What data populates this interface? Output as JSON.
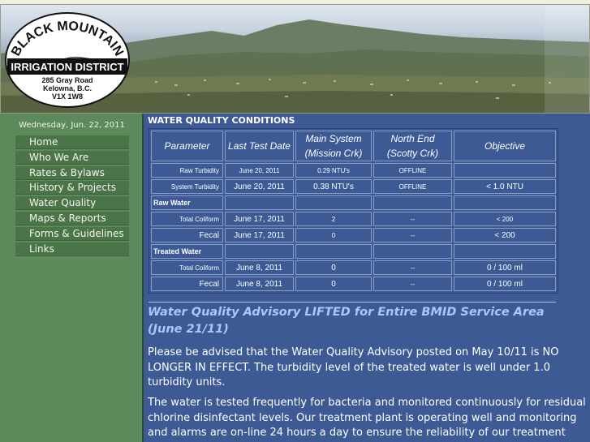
{
  "header": {
    "logo": {
      "name_top": "BLACK MOUNTAIN",
      "name_bottom": "IRRIGATION DISTRICT",
      "address_line1": "285 Gray Road",
      "address_line2": "Kelowna, B.C.",
      "address_line3": "V1X 1W8"
    }
  },
  "sidebar": {
    "date": "Wednesday, Jun. 22, 2011",
    "nav": [
      {
        "label": "Home"
      },
      {
        "label": "Who We Are"
      },
      {
        "label": "Rates & Bylaws"
      },
      {
        "label": "History & Projects"
      },
      {
        "label": "Water Quality"
      },
      {
        "label": "Maps & Reports"
      },
      {
        "label": "Forms & Guidelines"
      },
      {
        "label": "Links"
      }
    ]
  },
  "main": {
    "section_title": "WATER QUALITY CONDITIONS",
    "table": {
      "headers": {
        "parameter": "Parameter",
        "last_test_date": "Last Test Date",
        "main_line1": "Main System",
        "main_line2": "(Mission Crk)",
        "north_line1": "North End",
        "north_line2": "(Scotty Crk)",
        "objective": "Objective"
      },
      "rows": {
        "raw_turbidity": {
          "parameter": "Raw Turbidity",
          "date": "June 20, 2011",
          "main": "0.29 NTU's",
          "north": "OFFLINE",
          "objective": ""
        },
        "system_turbidity": {
          "parameter": "System Turbidity",
          "date": "June 20, 2011",
          "main": "0.38 NTU's",
          "north": "OFFLINE",
          "objective": "< 1.0 NTU"
        },
        "raw_water_section": "Raw Water",
        "raw_total_coliform": {
          "parameter": "Total Coliform",
          "date": "June 17, 2011",
          "main": "2",
          "north": "--",
          "objective": "< 200"
        },
        "raw_fecal": {
          "parameter": "Fecal",
          "date": "June 17, 2011",
          "main": "0",
          "north": "--",
          "objective": "< 200"
        },
        "treated_water_section": "Treated Water",
        "treated_total_coliform": {
          "parameter": "Total Coliform",
          "date": "June 8, 2011",
          "main": "0",
          "north": "--",
          "objective": "0 / 100 ml"
        },
        "treated_fecal": {
          "parameter": "Fecal",
          "date": "June 8, 2011",
          "main": "0",
          "north": "--",
          "objective": "0 / 100 ml"
        }
      }
    },
    "advisory": {
      "title": "Water Quality Advisory LIFTED for Entire BMID Service Area (June 21/11)",
      "paragraph1": "Please be advised that the Water Quality Advisory posted on May 10/11 is NO LONGER IN EFFECT.  The turbidity level of the treated water is well under 1.0 turbidity units.",
      "paragraph2": "The water is tested frequently for bacteria and monitored continuously for residual chlorine disinfectant levels.  Our treatment plant is operating well and monitoring and alarms are on-line 24 hours a day to ensure the reliability of our treatment process."
    }
  },
  "colors": {
    "sidebar_green": "#5d8a5b",
    "nav_item_green": "#4c7449",
    "main_blue": "#3d5a95",
    "advisory_title_blue": "#a8c8ff"
  }
}
